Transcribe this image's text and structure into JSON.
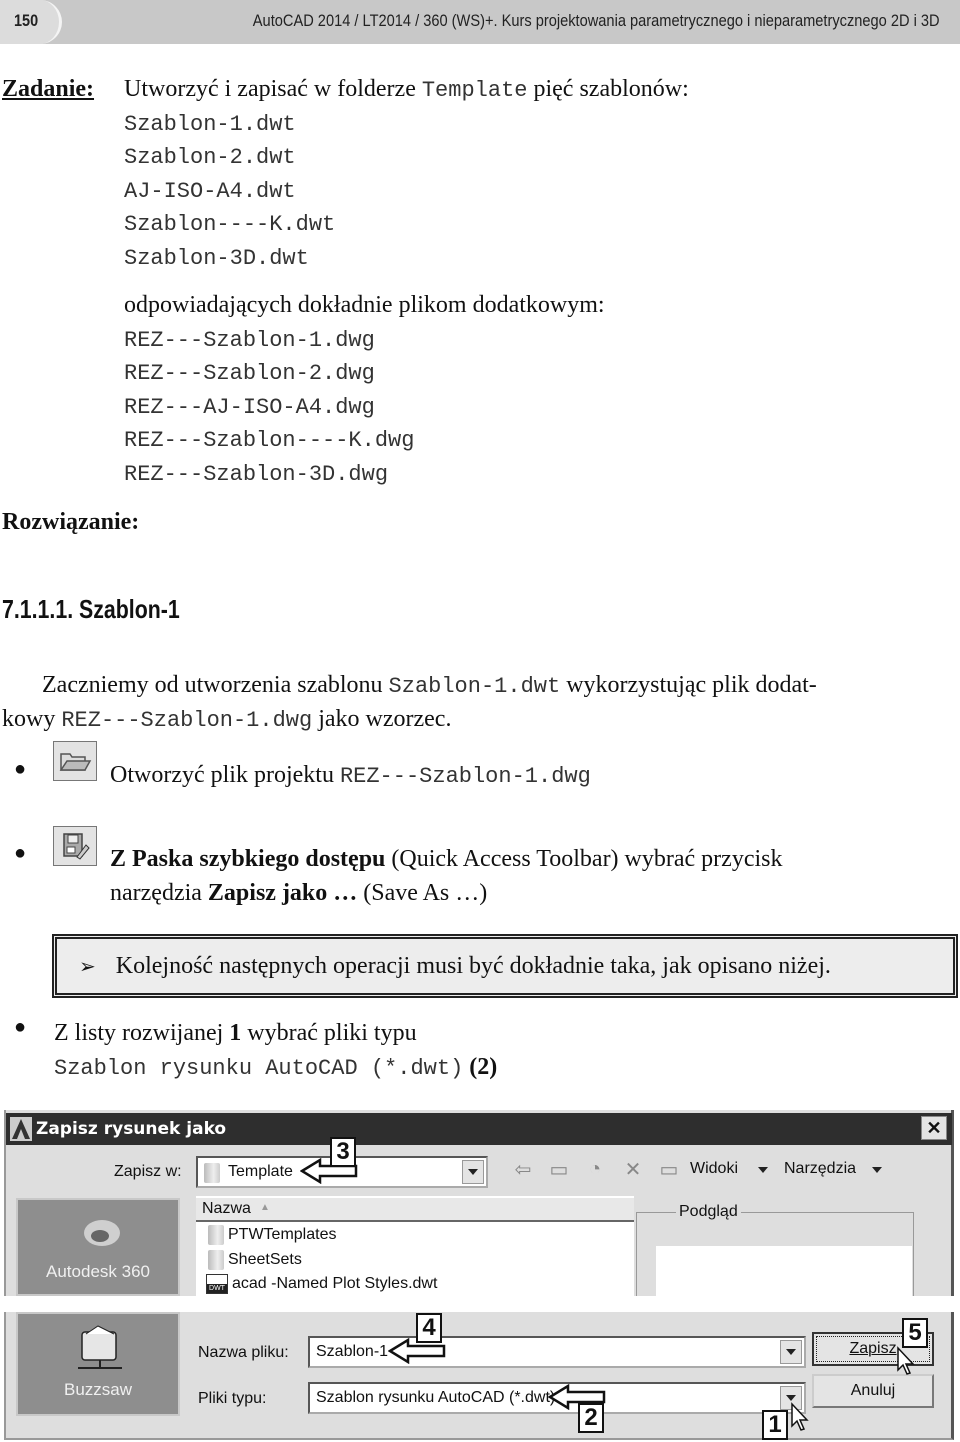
{
  "header": {
    "page_number": "150",
    "book_title": "AutoCAD 2014 / LT2014 / 360 (WS)+. Kurs projektowania parametrycznego i nieparametrycznego 2D i 3D"
  },
  "task": {
    "label": "Zadanie:",
    "intro_before": "Utworzyć i zapisać w folderze",
    "intro_folder": "Template",
    "intro_after": "pięć szablonów:",
    "templates": [
      "Szablon-1.dwt",
      "Szablon-2.dwt",
      "AJ-ISO-A4.dwt",
      "Szablon----K.dwt",
      "Szablon-3D.dwt"
    ],
    "match_text": "odpowiadających dokładnie plikom dodatkowym:",
    "source_files": [
      "REZ---Szablon-1.dwg",
      "REZ---Szablon-2.dwg",
      "REZ---AJ-ISO-A4.dwg",
      "REZ---Szablon----K.dwg",
      "REZ---Szablon-3D.dwg"
    ]
  },
  "solution": {
    "label": "Rozwiązanie:"
  },
  "section": {
    "heading": "7.1.1.1. Szablon-1",
    "para_line1_before": "Zaczniemy od utworzenia szablonu",
    "para_line1_code": "Szablon-1.dwt",
    "para_line1_after": "wykorzystując plik dodat-",
    "para_line2_before": "kowy",
    "para_line2_code": "REZ---Szablon-1.dwg",
    "para_line2_after": "jako wzorzec."
  },
  "steps": [
    {
      "icon": "open-folder-icon",
      "text": "Otworzyć plik projektu",
      "code": "REZ---Szablon-1.dwg"
    },
    {
      "icon": "save-as-icon",
      "text_pre": "Z",
      "bold1": "Paska szybkiego dostępu",
      "text_mid": "(Quick Access Toolbar) wybrać przycisk",
      "line2_pre": "narzędzia",
      "bold2": "Zapisz jako …",
      "line2_post": "(Save As …)"
    }
  ],
  "note": {
    "marker": "➢",
    "text": "Kolejność następnych operacji musi być dokładnie taka, jak opisano niżej."
  },
  "step3": {
    "pre": "Z listy rozwijanej",
    "bold_num": "1",
    "post": "wybrać pliki typu",
    "code": "Szablon rysunku AutoCAD (*.dwt)",
    "ref": "(2)"
  },
  "dialog": {
    "title": "Zapisz rysunek jako",
    "close": "✕",
    "save_in_label": "Zapisz w:",
    "save_in_value": "Template",
    "toolbar": {
      "back": "back-arrow-icon",
      "up": "up-folder-icon",
      "search_web": "search-web-icon",
      "delete": "delete-icon",
      "new_folder": "new-folder-icon",
      "views_label": "Widoki",
      "tools_label": "Narzędzia"
    },
    "list_header": "Nazwa",
    "files": [
      {
        "name": "PTWTemplates",
        "type": "folder"
      },
      {
        "name": "SheetSets",
        "type": "folder"
      },
      {
        "name": "acad -Named Plot Styles.dwt",
        "type": "dwt"
      }
    ],
    "dwt_badge": "DWT",
    "preview_label": "Podgląd",
    "places": [
      {
        "label": "Autodesk 360"
      },
      {
        "label": "Buzzsaw"
      }
    ],
    "filename_label": "Nazwa pliku:",
    "filename_value": "Szablon-1",
    "filetype_label": "Pliki typu:",
    "filetype_value": "Szablon rysunku AutoCAD (*.dwt)",
    "save_button": "Zapisz",
    "cancel_button": "Anuluj",
    "callouts": [
      "1",
      "2",
      "3",
      "4",
      "5"
    ]
  },
  "colors": {
    "header_bg": "#c8c8c8",
    "titlebar_bg": "#2e2e2e",
    "dialog_bg": "#dedede",
    "side_tile_bg": "#8e8e8e"
  }
}
